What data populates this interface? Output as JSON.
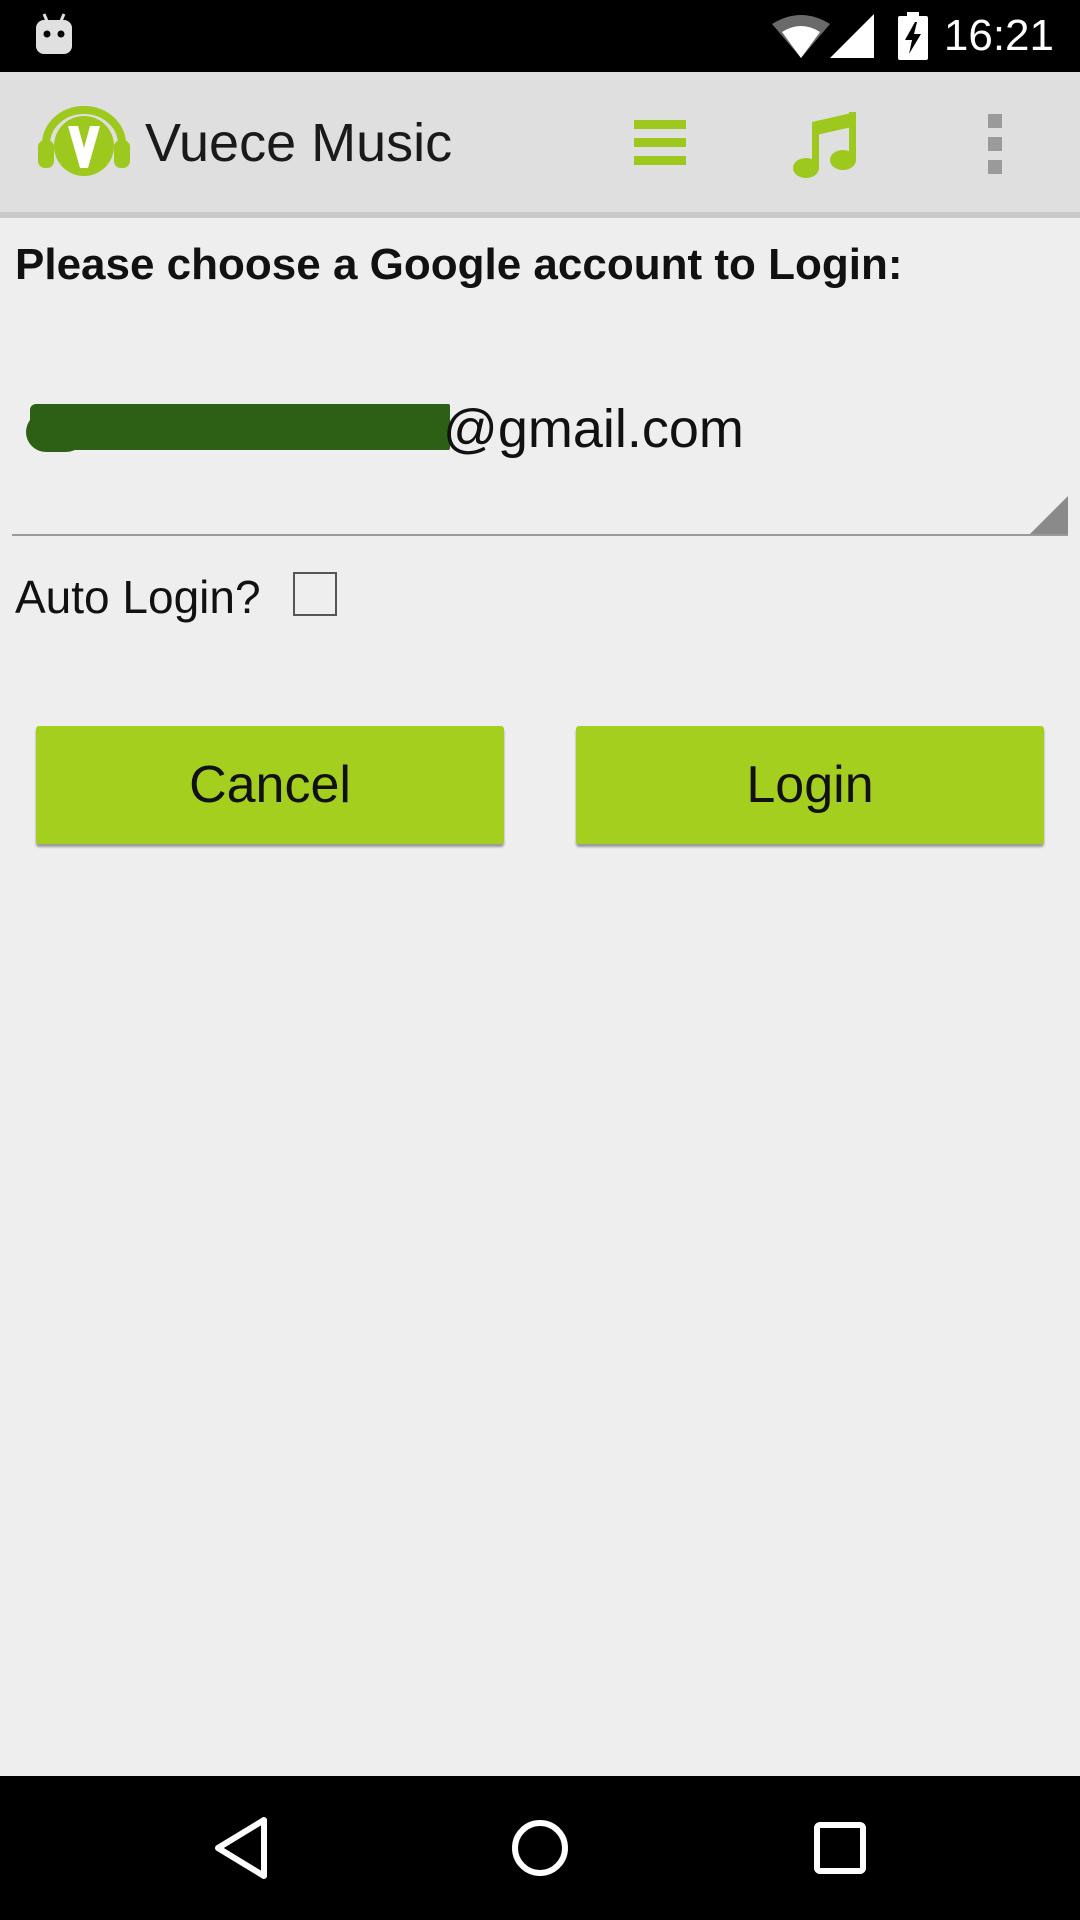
{
  "status_bar": {
    "time": "16:21",
    "icons": [
      "android-notification-icon",
      "wifi-icon",
      "cell-signal-icon",
      "battery-charging-icon"
    ]
  },
  "action_bar": {
    "title": "Vuece Music",
    "logo": "vuece-logo-icon",
    "actions": [
      "menu-icon",
      "music-note-icon",
      "overflow-menu-icon"
    ],
    "accent_color": "#9dc81d"
  },
  "login_form": {
    "prompt": "Please choose a Google account to Login:",
    "account_suffix": "@gmail.com",
    "auto_login_label": "Auto Login?",
    "auto_login_checked": false,
    "cancel_label": "Cancel",
    "login_label": "Login",
    "button_color": "#a4cf1f"
  },
  "nav_bar": {
    "icons": [
      "back-icon",
      "home-icon",
      "recents-icon"
    ]
  }
}
